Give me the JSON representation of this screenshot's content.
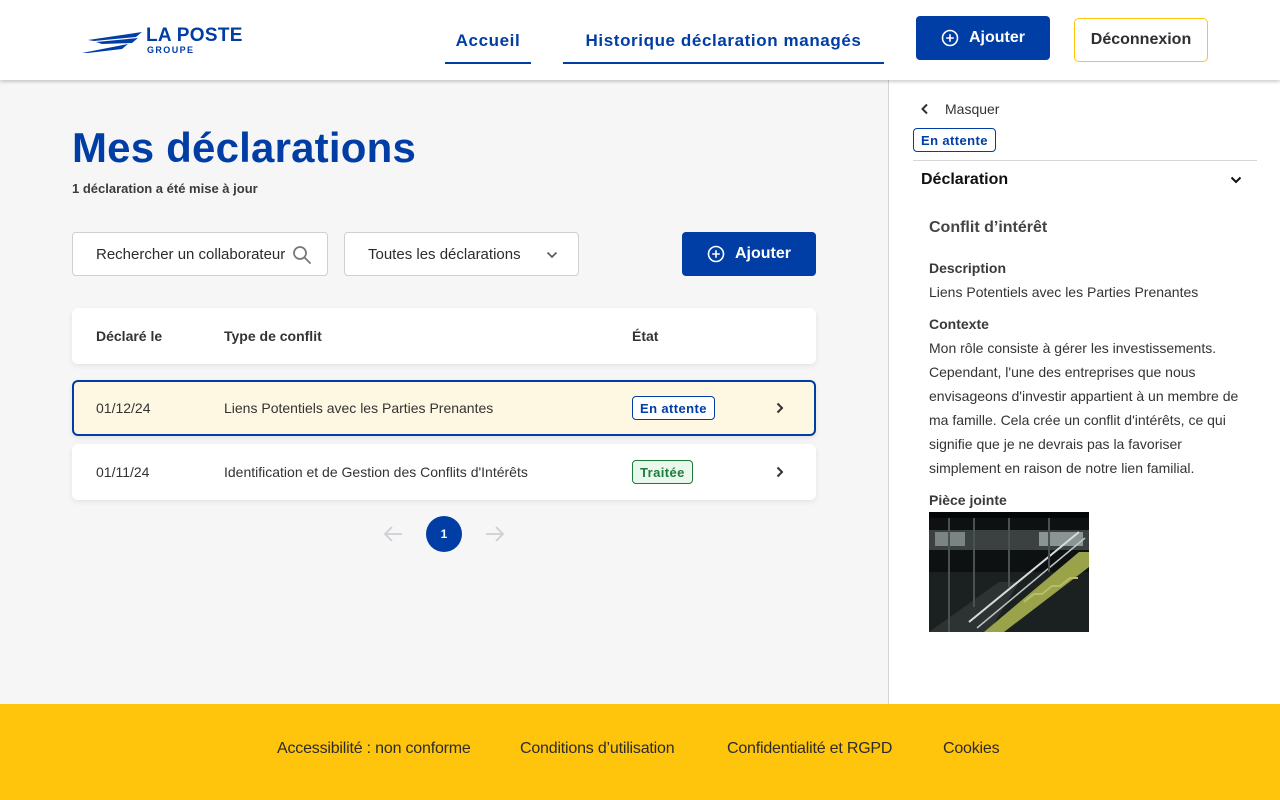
{
  "brand": {
    "name": "LA POSTE",
    "subname": "GROUPE",
    "logo_icon": "la-poste-logo",
    "colors": {
      "primary": "#003da5",
      "accent": "#ffc40c"
    }
  },
  "header": {
    "nav": [
      "Accueil",
      "Historique déclaration managés"
    ],
    "add_label": "Ajouter",
    "logout_label": "Déconnexion"
  },
  "main": {
    "title": "Mes déclarations",
    "subtitle": "1 déclaration a été mise à jour",
    "search_placeholder": "Rechercher un collaborateur",
    "filter_value": "Toutes les déclarations",
    "add_label": "Ajouter",
    "table": {
      "columns": [
        "Déclaré le",
        "Type de conflit",
        "État"
      ],
      "rows": [
        {
          "date": "01/12/24",
          "type": "Liens Potentiels avec les Parties Prenantes",
          "status": "En attente"
        },
        {
          "date": "01/11/24",
          "type": "Identification et de Gestion des Conflits d'Intérêts",
          "status": "Traitée"
        }
      ]
    },
    "pagination": {
      "current_page": "1"
    }
  },
  "panel": {
    "back_label": "Masquer",
    "status": "En attente",
    "section_title": "Déclaration",
    "subtitle": "Conflit d’intérêt",
    "description_label": "Description",
    "description": "Liens Potentiels avec les Parties Prenantes",
    "context_label": "Contexte",
    "context_lines": [
      "Mon rôle consiste à gérer les investissements.",
      "Cependant, l'une des entreprises que nous",
      "envisageons d'investir appartient  à un membre de",
      "ma famille. Cela crée un conflit d'intérêts, ce qui",
      "signifie que je ne devrais pas la favoriser",
      "simplement en raison de notre lien familial."
    ],
    "attachment_label": "Pièce jointe"
  },
  "footer": {
    "links": [
      "Accessibilité : non conforme",
      "Conditions d’utilisation",
      "Confidentialité et RGPD",
      "Cookies"
    ]
  }
}
